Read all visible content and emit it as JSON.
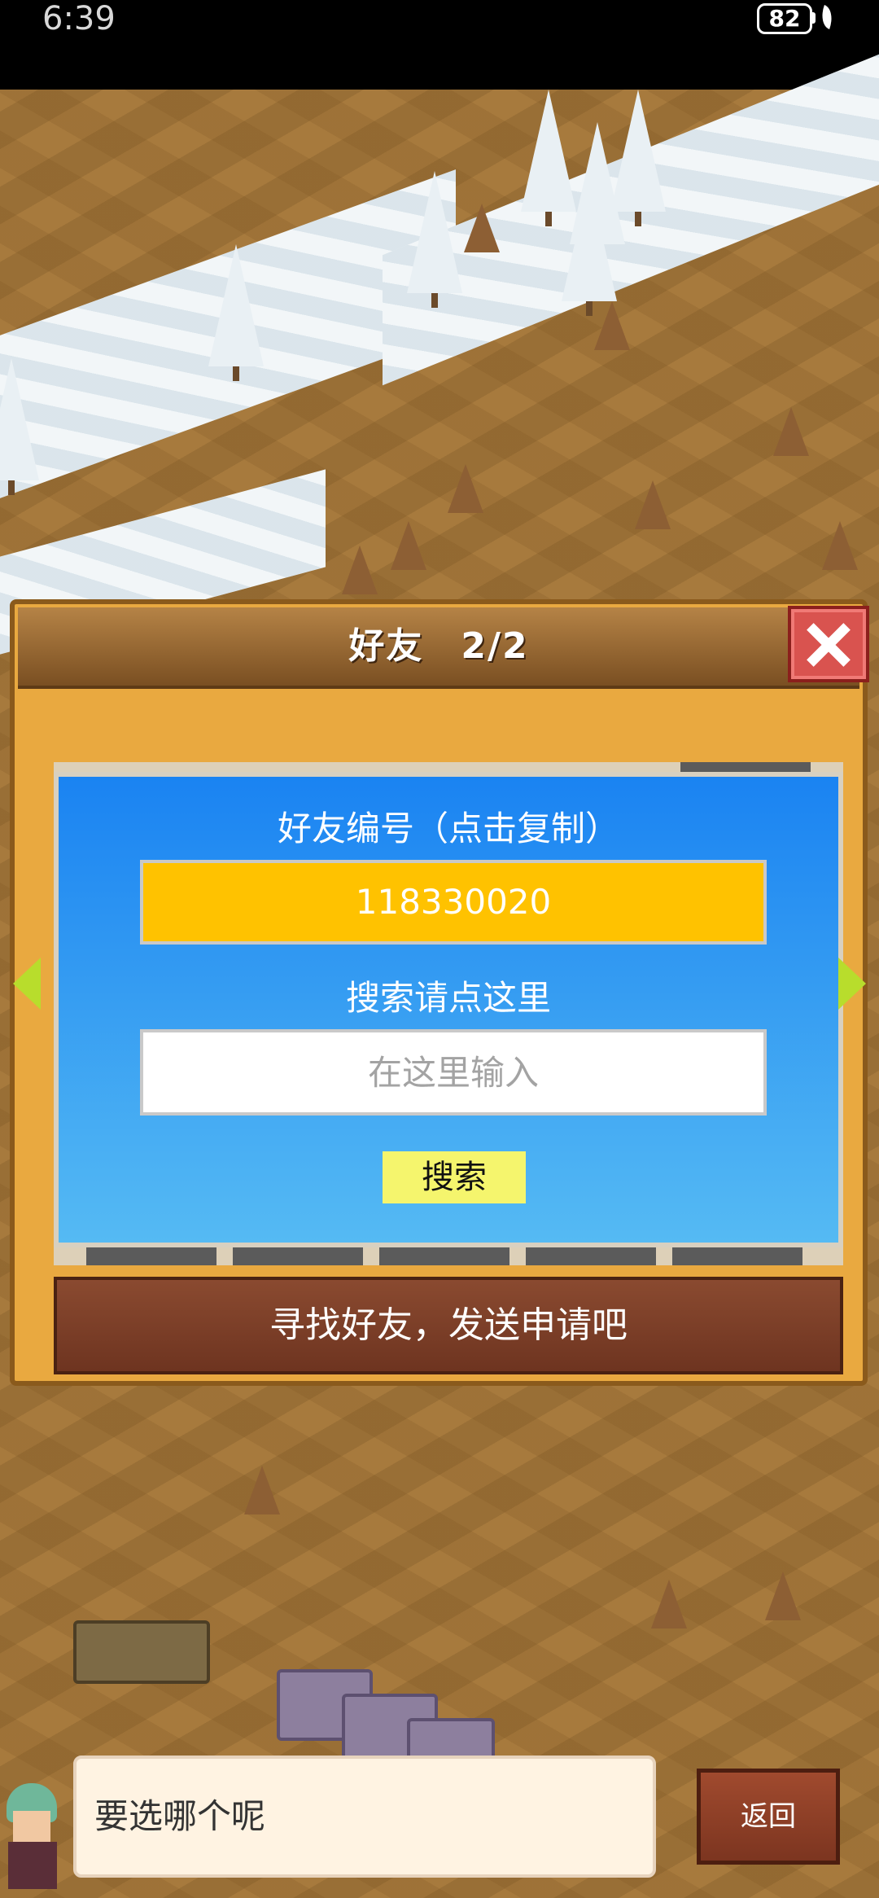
{
  "status_bar": {
    "time": "6:39",
    "battery": "82"
  },
  "dialog": {
    "title": "好友　2/2",
    "friend_id_label": "好友编号（点击复制）",
    "friend_id": "118330020",
    "search_label": "搜索请点这里",
    "search_placeholder": "在这里输入",
    "search_button": "搜索",
    "find_friends_button": "寻找好友，发送申请吧"
  },
  "bottom": {
    "speech": "要选哪个呢",
    "back_button": "返回"
  },
  "colors": {
    "panel_blue": "#1a83f2",
    "id_box": "#ffc200",
    "search_button": "#f5f56d",
    "close_red": "#d9534f"
  },
  "icons": [
    "close-icon",
    "left-arrow-icon",
    "right-arrow-icon",
    "battery-icon",
    "leaf-icon"
  ]
}
